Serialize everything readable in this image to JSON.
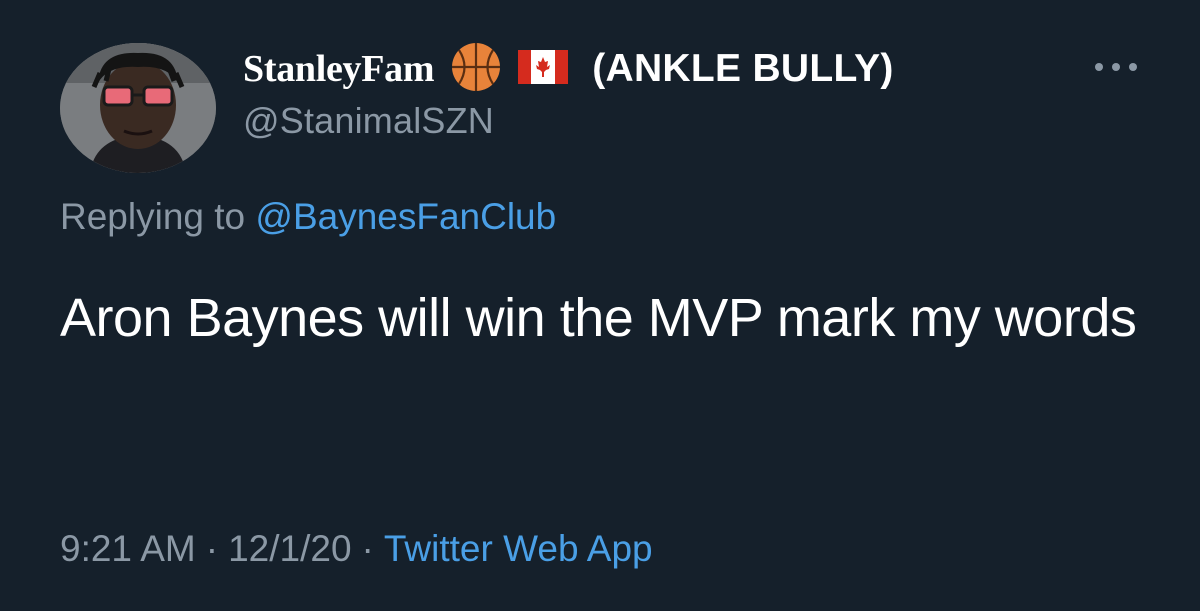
{
  "author": {
    "display_name": "StanleyFam",
    "badge_emojis": [
      "basketball-emoji",
      "canada-flag-emoji"
    ],
    "name_suffix": "(ANKLE BULLY)",
    "handle": "@StanimalSZN"
  },
  "reply": {
    "prefix": "Replying to",
    "mention": "@BaynesFanClub"
  },
  "tweet": {
    "text": "Aron Baynes will win the MVP mark my words"
  },
  "meta": {
    "time": "9:21 AM",
    "separator": "·",
    "date": "12/1/20",
    "source": "Twitter Web App"
  },
  "colors": {
    "background": "#15202b",
    "text_primary": "#ffffff",
    "text_secondary": "#8b98a5",
    "link": "#4a9fe6"
  }
}
